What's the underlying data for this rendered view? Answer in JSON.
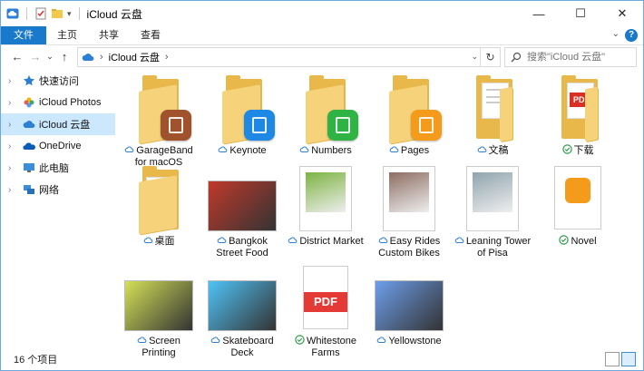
{
  "window": {
    "title": "iCloud 云盘"
  },
  "ribbon": {
    "tabs": [
      "文件",
      "主页",
      "共享",
      "查看"
    ],
    "help": "?"
  },
  "address": {
    "path": "iCloud 云盘"
  },
  "search": {
    "placeholder": "搜索\"iCloud 云盘\""
  },
  "nav": {
    "items": [
      {
        "label": "快速访问",
        "icon": "star-icon"
      },
      {
        "label": "iCloud Photos",
        "icon": "photos-icon"
      },
      {
        "label": "iCloud 云盘",
        "icon": "icloud-icon",
        "selected": true
      },
      {
        "label": "OneDrive",
        "icon": "onedrive-icon"
      },
      {
        "label": "此电脑",
        "icon": "pc-icon"
      },
      {
        "label": "网络",
        "icon": "network-icon"
      }
    ]
  },
  "items": [
    {
      "line1": "GarageBand",
      "line2": "for macOS",
      "status": "cloud",
      "kind": "folder-app",
      "color": "#a0522d"
    },
    {
      "line1": "Keynote",
      "line2": "",
      "status": "cloud",
      "kind": "folder-app",
      "color": "#1e88e5"
    },
    {
      "line1": "Numbers",
      "line2": "",
      "status": "cloud",
      "kind": "folder-app",
      "color": "#2fb344"
    },
    {
      "line1": "Pages",
      "line2": "",
      "status": "cloud",
      "kind": "folder-app",
      "color": "#f59b1b"
    },
    {
      "line1": "文稿",
      "line2": "",
      "status": "cloud",
      "kind": "folder-docs"
    },
    {
      "line1": "下载",
      "line2": "",
      "status": "check",
      "kind": "folder-pdf"
    },
    {
      "line1": "桌面",
      "line2": "",
      "status": "cloud",
      "kind": "folder-doc"
    },
    {
      "line1": "Bangkok",
      "line2": "Street Food",
      "status": "cloud",
      "kind": "photo",
      "color": "#c0392b"
    },
    {
      "line1": "District Market",
      "line2": "",
      "status": "cloud",
      "kind": "page",
      "color": "#7cb342"
    },
    {
      "line1": "Easy Rides",
      "line2": "Custom Bikes",
      "status": "cloud",
      "kind": "page",
      "color": "#8d6e63"
    },
    {
      "line1": "Leaning Tower",
      "line2": "of Pisa",
      "status": "cloud",
      "kind": "page",
      "color": "#90a4ae"
    },
    {
      "line1": "Novel",
      "line2": "",
      "status": "check",
      "kind": "pages-doc",
      "color": "#f59b1b"
    },
    {
      "line1": "Screen",
      "line2": "Printing",
      "status": "cloud",
      "kind": "photo",
      "color": "#d4e157"
    },
    {
      "line1": "Skateboard",
      "line2": "Deck",
      "status": "cloud",
      "kind": "photo",
      "color": "#4fc3f7"
    },
    {
      "line1": "Whitestone",
      "line2": "Farms",
      "status": "check",
      "kind": "pdf",
      "color": "#e53935"
    },
    {
      "line1": "Yellowstone",
      "line2": "",
      "status": "cloud",
      "kind": "photo",
      "color": "#6d9eeb"
    }
  ],
  "pdf_text": "PDF",
  "status": {
    "count": "16 个项目"
  }
}
